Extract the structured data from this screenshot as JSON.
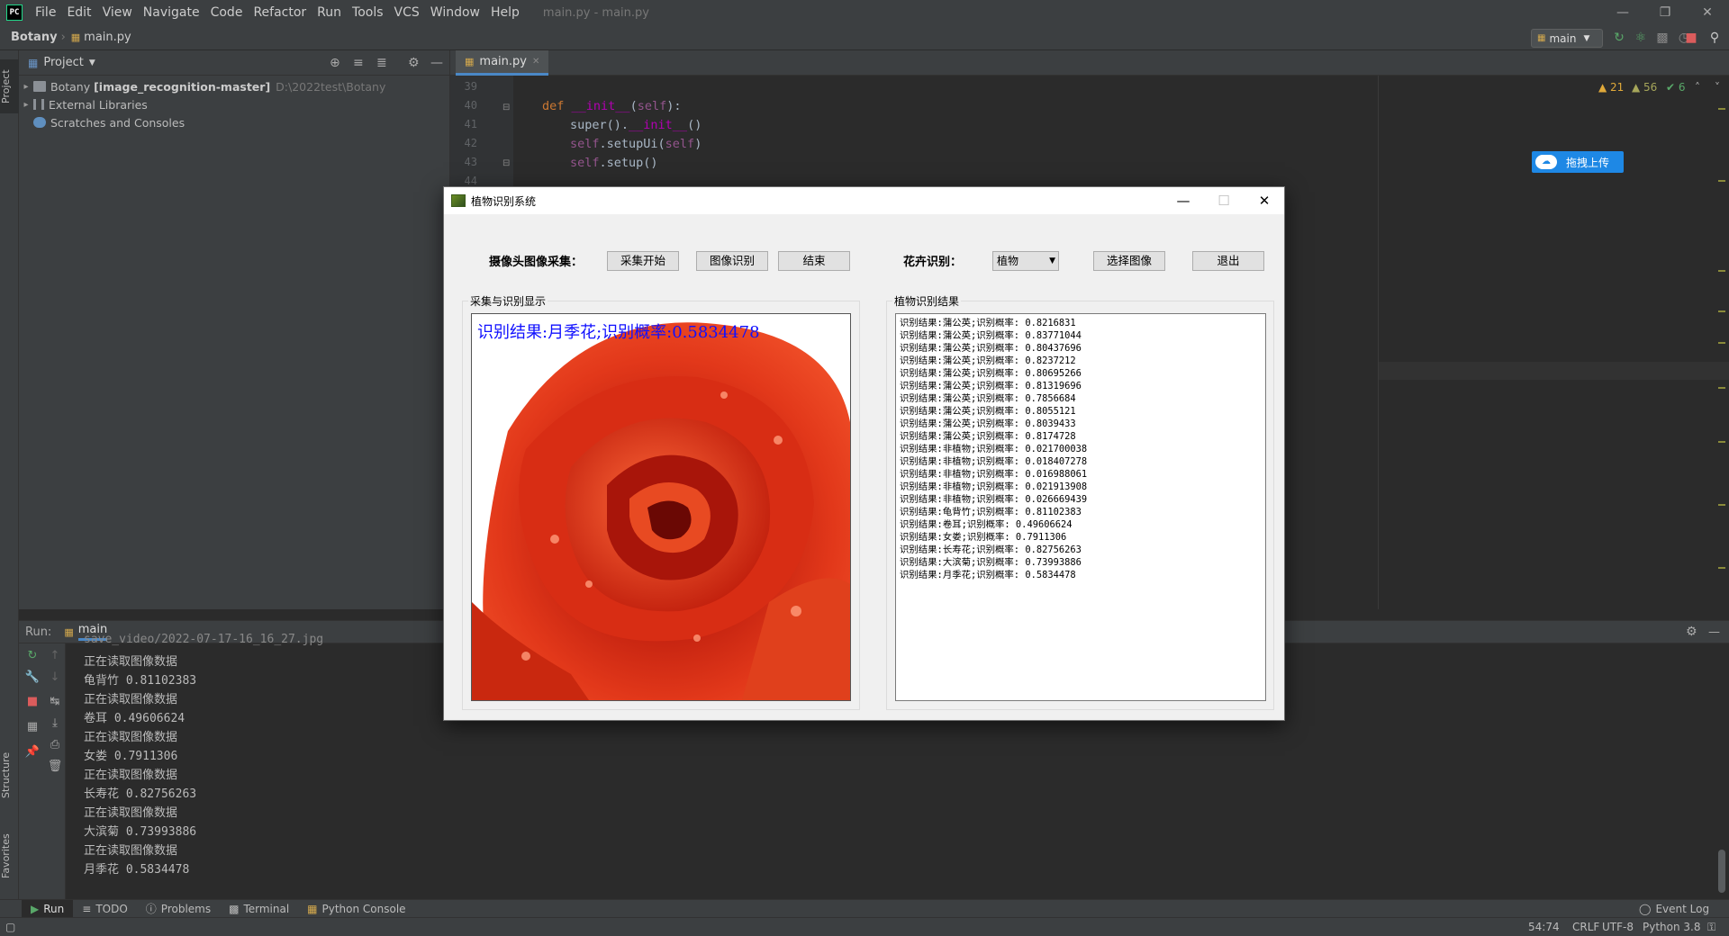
{
  "menubar": {
    "logo": "PC",
    "items": [
      "File",
      "Edit",
      "View",
      "Navigate",
      "Code",
      "Refactor",
      "Run",
      "Tools",
      "VCS",
      "Window",
      "Help"
    ],
    "window_title": "main.py - main.py"
  },
  "navbar": {
    "project": "Botany",
    "file": "main.py",
    "run_config": "main"
  },
  "left_stripe": {
    "project_tab": "Project",
    "structure_tab": "Structure",
    "favorites_tab": "Favorites"
  },
  "project_panel": {
    "title": "Project",
    "tree": [
      {
        "name": "Botany",
        "bold_part": "[image_recognition-master]",
        "path": "D:\\2022test\\Botany"
      },
      {
        "name": "External Libraries"
      },
      {
        "name": "Scratches and Consoles"
      }
    ]
  },
  "editor": {
    "tab": "main.py",
    "line_numbers": [
      "39",
      "40",
      "41",
      "42",
      "43",
      "44"
    ],
    "inspections": {
      "warnings": "21",
      "weak_warnings": "56",
      "ok": "6"
    },
    "baidu_button": "拖拽上传"
  },
  "run_panel": {
    "label": "Run:",
    "config": "main",
    "lines": [
      "save_video/2022-07-17-16_16_27.jpg",
      "正在读取图像数据",
      "龟背竹 0.81102383",
      "正在读取图像数据",
      "卷耳 0.49606624",
      "正在读取图像数据",
      "女娄 0.7911306",
      "正在读取图像数据",
      "长寿花 0.82756263",
      "正在读取图像数据",
      "大滨菊 0.73993886",
      "正在读取图像数据",
      "月季花 0.5834478"
    ]
  },
  "bottom_tabs": [
    "Run",
    "TODO",
    "Problems",
    "Terminal",
    "Python Console"
  ],
  "event_log": "Event Log",
  "status": {
    "position": "54:74",
    "line_sep": "CRLF",
    "encoding": "UTF-8",
    "interpreter": "Python 3.8"
  },
  "dialog": {
    "title": "植物识别系统",
    "camera_label": "摄像头图像采集：",
    "btn_start": "采集开始",
    "btn_recognize": "图像识别",
    "btn_end": "结束",
    "flower_label": "花卉识别：",
    "combo_value": "植物",
    "btn_select": "选择图像",
    "btn_exit": "退出",
    "group_display": "采集与识别显示",
    "group_result": "植物识别结果",
    "overlay_text": "识别结果:月季花;识别概率:0.5834478",
    "results": [
      "识别结果:蒲公英;识别概率: 0.8216831",
      "识别结果:蒲公英;识别概率: 0.83771044",
      "识别结果:蒲公英;识别概率: 0.80437696",
      "识别结果:蒲公英;识别概率: 0.8237212",
      "识别结果:蒲公英;识别概率: 0.80695266",
      "识别结果:蒲公英;识别概率: 0.81319696",
      "识别结果:蒲公英;识别概率: 0.7856684",
      "识别结果:蒲公英;识别概率: 0.8055121",
      "识别结果:蒲公英;识别概率: 0.8039433",
      "识别结果:蒲公英;识别概率: 0.8174728",
      "识别结果:非植物;识别概率: 0.021700038",
      "识别结果:非植物;识别概率: 0.018407278",
      "识别结果:非植物;识别概率: 0.016988061",
      "识别结果:非植物;识别概率: 0.021913908",
      "识别结果:非植物;识别概率: 0.026669439",
      "识别结果:龟背竹;识别概率: 0.81102383",
      "识别结果:卷耳;识别概率: 0.49606624",
      "识别结果:女娄;识别概率: 0.7911306",
      "识别结果:长寿花;识别概率: 0.82756263",
      "识别结果:大滨菊;识别概率: 0.73993886",
      "识别结果:月季花;识别概率: 0.5834478"
    ]
  },
  "colors": {
    "ide_bg": "#2b2b2b",
    "panel_bg": "#3c3f41",
    "accent": "#4a88c7",
    "rose_red": "#d42a12",
    "overlay_blue": "#1010ff"
  }
}
